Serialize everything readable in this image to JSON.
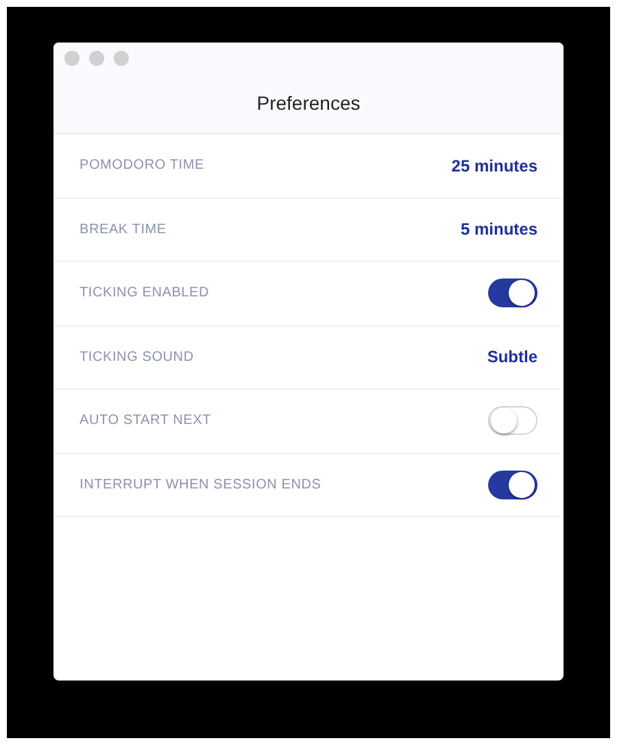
{
  "window": {
    "title": "Preferences"
  },
  "settings": [
    {
      "kind": "value",
      "label": "POMODORO TIME",
      "value": "25 minutes"
    },
    {
      "kind": "value",
      "label": "BREAK TIME",
      "value": "5 minutes"
    },
    {
      "kind": "toggle",
      "label": "TICKING ENABLED",
      "on": true
    },
    {
      "kind": "value",
      "label": "TICKING SOUND",
      "value": "Subtle"
    },
    {
      "kind": "toggle",
      "label": "AUTO START NEXT",
      "on": false
    },
    {
      "kind": "toggle",
      "label": "INTERRUPT WHEN SESSION ENDS",
      "on": true
    }
  ]
}
